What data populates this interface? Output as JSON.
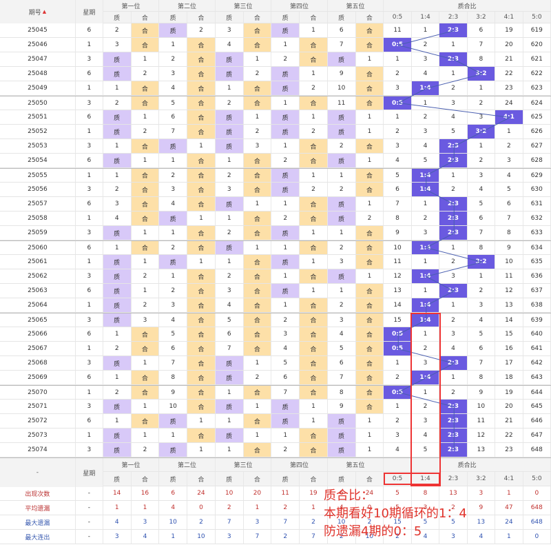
{
  "header": {
    "period": "期号",
    "week": "星期",
    "positions": [
      "第一位",
      "第二位",
      "第三位",
      "第四位",
      "第五位"
    ],
    "zhi": "质",
    "he": "合",
    "ratio_title": "质合比",
    "ratios": [
      "0:5",
      "1:4",
      "2:3",
      "3:2",
      "4:1",
      "5:0"
    ]
  },
  "chart_data": {
    "type": "table",
    "rows": [
      {
        "p": "25045",
        "w": "6",
        "pos": [
          [
            "2",
            "合"
          ],
          [
            "质",
            "2"
          ],
          [
            "3",
            "合"
          ],
          [
            "质",
            "1"
          ],
          [
            "6",
            "合"
          ]
        ],
        "ratio": [
          "11",
          "1",
          "2:3",
          "6",
          "19",
          "619"
        ],
        "hit": 2
      },
      {
        "p": "25046",
        "w": "1",
        "pos": [
          [
            "3",
            "合"
          ],
          [
            "1",
            "合"
          ],
          [
            "4",
            "合"
          ],
          [
            "1",
            "合"
          ],
          [
            "7",
            "合"
          ]
        ],
        "ratio": [
          "0:5",
          "2",
          "1",
          "7",
          "20",
          "620"
        ],
        "hit": 0
      },
      {
        "p": "25047",
        "w": "3",
        "pos": [
          [
            "质",
            "1"
          ],
          [
            "2",
            "合"
          ],
          [
            "质",
            "1"
          ],
          [
            "2",
            "合"
          ],
          [
            "质",
            "1"
          ]
        ],
        "ratio": [
          "1",
          "3",
          "2:3",
          "8",
          "21",
          "621"
        ],
        "hit": 2
      },
      {
        "p": "25048",
        "w": "6",
        "pos": [
          [
            "质",
            "2"
          ],
          [
            "3",
            "合"
          ],
          [
            "质",
            "2"
          ],
          [
            "质",
            "1"
          ],
          [
            "9",
            "合"
          ]
        ],
        "ratio": [
          "2",
          "4",
          "1",
          "3:2",
          "22",
          "622"
        ],
        "hit": 3
      },
      {
        "p": "25049",
        "w": "1",
        "pos": [
          [
            "1",
            "合"
          ],
          [
            "4",
            "合"
          ],
          [
            "1",
            "合"
          ],
          [
            "质",
            "2"
          ],
          [
            "10",
            "合"
          ]
        ],
        "ratio": [
          "3",
          "1:4",
          "2",
          "1",
          "23",
          "623"
        ],
        "hit": 1
      },
      {
        "p": "25050",
        "w": "3",
        "pos": [
          [
            "2",
            "合"
          ],
          [
            "5",
            "合"
          ],
          [
            "2",
            "合"
          ],
          [
            "1",
            "合"
          ],
          [
            "11",
            "合"
          ]
        ],
        "ratio": [
          "0:5",
          "1",
          "3",
          "2",
          "24",
          "624"
        ],
        "hit": 0
      },
      {
        "p": "25051",
        "w": "6",
        "pos": [
          [
            "质",
            "1"
          ],
          [
            "6",
            "合"
          ],
          [
            "质",
            "1"
          ],
          [
            "质",
            "1"
          ],
          [
            "质",
            "1"
          ]
        ],
        "ratio": [
          "1",
          "2",
          "4",
          "3",
          "4:1",
          "625"
        ],
        "hit": 4
      },
      {
        "p": "25052",
        "w": "1",
        "pos": [
          [
            "质",
            "2"
          ],
          [
            "7",
            "合"
          ],
          [
            "质",
            "2"
          ],
          [
            "质",
            "2"
          ],
          [
            "质",
            "1"
          ]
        ],
        "ratio": [
          "2",
          "3",
          "5",
          "3:2",
          "1",
          "626"
        ],
        "hit": 3
      },
      {
        "p": "25053",
        "w": "3",
        "pos": [
          [
            "1",
            "合"
          ],
          [
            "质",
            "1"
          ],
          [
            "质",
            "3"
          ],
          [
            "1",
            "合"
          ],
          [
            "2",
            "合"
          ]
        ],
        "ratio": [
          "3",
          "4",
          "2:3",
          "1",
          "2",
          "627"
        ],
        "hit": 2
      },
      {
        "p": "25054",
        "w": "6",
        "pos": [
          [
            "质",
            "1"
          ],
          [
            "1",
            "合"
          ],
          [
            "1",
            "合"
          ],
          [
            "2",
            "合"
          ],
          [
            "质",
            "1"
          ]
        ],
        "ratio": [
          "4",
          "5",
          "2:3",
          "2",
          "3",
          "628"
        ],
        "hit": 2
      },
      {
        "p": "25055",
        "w": "1",
        "pos": [
          [
            "1",
            "合"
          ],
          [
            "2",
            "合"
          ],
          [
            "2",
            "合"
          ],
          [
            "质",
            "1"
          ],
          [
            "1",
            "合"
          ]
        ],
        "ratio": [
          "5",
          "1:4",
          "1",
          "3",
          "4",
          "629"
        ],
        "hit": 1
      },
      {
        "p": "25056",
        "w": "3",
        "pos": [
          [
            "2",
            "合"
          ],
          [
            "3",
            "合"
          ],
          [
            "3",
            "合"
          ],
          [
            "质",
            "2"
          ],
          [
            "2",
            "合"
          ]
        ],
        "ratio": [
          "6",
          "1:4",
          "2",
          "4",
          "5",
          "630"
        ],
        "hit": 1
      },
      {
        "p": "25057",
        "w": "6",
        "pos": [
          [
            "3",
            "合"
          ],
          [
            "4",
            "合"
          ],
          [
            "质",
            "1"
          ],
          [
            "1",
            "合"
          ],
          [
            "质",
            "1"
          ]
        ],
        "ratio": [
          "7",
          "1",
          "2:3",
          "5",
          "6",
          "631"
        ],
        "hit": 2
      },
      {
        "p": "25058",
        "w": "1",
        "pos": [
          [
            "4",
            "合"
          ],
          [
            "质",
            "1"
          ],
          [
            "1",
            "合"
          ],
          [
            "2",
            "合"
          ],
          [
            "质",
            "2"
          ]
        ],
        "ratio": [
          "8",
          "2",
          "2:3",
          "6",
          "7",
          "632"
        ],
        "hit": 2
      },
      {
        "p": "25059",
        "w": "3",
        "pos": [
          [
            "质",
            "1"
          ],
          [
            "1",
            "合"
          ],
          [
            "2",
            "合"
          ],
          [
            "质",
            "1"
          ],
          [
            "1",
            "合"
          ]
        ],
        "ratio": [
          "9",
          "3",
          "2:3",
          "7",
          "8",
          "633"
        ],
        "hit": 2
      },
      {
        "p": "25060",
        "w": "6",
        "pos": [
          [
            "1",
            "合"
          ],
          [
            "2",
            "合"
          ],
          [
            "质",
            "1"
          ],
          [
            "1",
            "合"
          ],
          [
            "2",
            "合"
          ]
        ],
        "ratio": [
          "10",
          "1:4",
          "1",
          "8",
          "9",
          "634"
        ],
        "hit": 1
      },
      {
        "p": "25061",
        "w": "1",
        "pos": [
          [
            "质",
            "1"
          ],
          [
            "质",
            "1"
          ],
          [
            "1",
            "合"
          ],
          [
            "质",
            "1"
          ],
          [
            "3",
            "合"
          ]
        ],
        "ratio": [
          "11",
          "1",
          "2",
          "3:2",
          "10",
          "635"
        ],
        "hit": 3
      },
      {
        "p": "25062",
        "w": "3",
        "pos": [
          [
            "质",
            "2"
          ],
          [
            "1",
            "合"
          ],
          [
            "2",
            "合"
          ],
          [
            "1",
            "合"
          ],
          [
            "质",
            "1"
          ]
        ],
        "ratio": [
          "12",
          "1:4",
          "3",
          "1",
          "11",
          "636"
        ],
        "hit": 1
      },
      {
        "p": "25063",
        "w": "6",
        "pos": [
          [
            "质",
            "1"
          ],
          [
            "2",
            "合"
          ],
          [
            "3",
            "合"
          ],
          [
            "质",
            "1"
          ],
          [
            "1",
            "合"
          ]
        ],
        "ratio": [
          "13",
          "1",
          "2:3",
          "2",
          "12",
          "637"
        ],
        "hit": 2
      },
      {
        "p": "25064",
        "w": "1",
        "pos": [
          [
            "质",
            "2"
          ],
          [
            "3",
            "合"
          ],
          [
            "4",
            "合"
          ],
          [
            "1",
            "合"
          ],
          [
            "2",
            "合"
          ]
        ],
        "ratio": [
          "14",
          "1:4",
          "1",
          "3",
          "13",
          "638"
        ],
        "hit": 1
      },
      {
        "p": "25065",
        "w": "3",
        "pos": [
          [
            "质",
            "3"
          ],
          [
            "4",
            "合"
          ],
          [
            "5",
            "合"
          ],
          [
            "2",
            "合"
          ],
          [
            "3",
            "合"
          ]
        ],
        "ratio": [
          "15",
          "1:4",
          "2",
          "4",
          "14",
          "639"
        ],
        "hit": 1
      },
      {
        "p": "25066",
        "w": "6",
        "pos": [
          [
            "1",
            "合"
          ],
          [
            "5",
            "合"
          ],
          [
            "6",
            "合"
          ],
          [
            "3",
            "合"
          ],
          [
            "4",
            "合"
          ]
        ],
        "ratio": [
          "0:5",
          "1",
          "3",
          "5",
          "15",
          "640"
        ],
        "hit": 0
      },
      {
        "p": "25067",
        "w": "1",
        "pos": [
          [
            "2",
            "合"
          ],
          [
            "6",
            "合"
          ],
          [
            "7",
            "合"
          ],
          [
            "4",
            "合"
          ],
          [
            "5",
            "合"
          ]
        ],
        "ratio": [
          "0:5",
          "2",
          "4",
          "6",
          "16",
          "641"
        ],
        "hit": 0
      },
      {
        "p": "25068",
        "w": "3",
        "pos": [
          [
            "质",
            "1"
          ],
          [
            "7",
            "合"
          ],
          [
            "质",
            "1"
          ],
          [
            "5",
            "合"
          ],
          [
            "6",
            "合"
          ]
        ],
        "ratio": [
          "1",
          "3",
          "2:3",
          "7",
          "17",
          "642"
        ],
        "hit": 2
      },
      {
        "p": "25069",
        "w": "6",
        "pos": [
          [
            "1",
            "合"
          ],
          [
            "8",
            "合"
          ],
          [
            "质",
            "2"
          ],
          [
            "6",
            "合"
          ],
          [
            "7",
            "合"
          ]
        ],
        "ratio": [
          "2",
          "1:4",
          "1",
          "8",
          "18",
          "643"
        ],
        "hit": 1
      },
      {
        "p": "25070",
        "w": "1",
        "pos": [
          [
            "2",
            "合"
          ],
          [
            "9",
            "合"
          ],
          [
            "1",
            "合"
          ],
          [
            "7",
            "合"
          ],
          [
            "8",
            "合"
          ]
        ],
        "ratio": [
          "0:5",
          "1",
          "2",
          "9",
          "19",
          "644"
        ],
        "hit": 0
      },
      {
        "p": "25071",
        "w": "3",
        "pos": [
          [
            "质",
            "1"
          ],
          [
            "10",
            "合"
          ],
          [
            "质",
            "1"
          ],
          [
            "质",
            "1"
          ],
          [
            "9",
            "合"
          ]
        ],
        "ratio": [
          "1",
          "2",
          "2:3",
          "10",
          "20",
          "645"
        ],
        "hit": 2
      },
      {
        "p": "25072",
        "w": "6",
        "pos": [
          [
            "1",
            "合"
          ],
          [
            "质",
            "1"
          ],
          [
            "1",
            "合"
          ],
          [
            "质",
            "1"
          ],
          [
            "质",
            "1"
          ]
        ],
        "ratio": [
          "2",
          "3",
          "2:3",
          "11",
          "21",
          "646"
        ],
        "hit": 2
      },
      {
        "p": "25073",
        "w": "1",
        "pos": [
          [
            "质",
            "1"
          ],
          [
            "1",
            "合"
          ],
          [
            "质",
            "1"
          ],
          [
            "1",
            "合"
          ],
          [
            "质",
            "1"
          ]
        ],
        "ratio": [
          "3",
          "4",
          "2:3",
          "12",
          "22",
          "647"
        ],
        "hit": 2
      },
      {
        "p": "25074",
        "w": "3",
        "pos": [
          [
            "质",
            "2"
          ],
          [
            "质",
            "1"
          ],
          [
            "1",
            "合"
          ],
          [
            "2",
            "合"
          ],
          [
            "质",
            "1"
          ]
        ],
        "ratio": [
          "4",
          "5",
          "2:3",
          "13",
          "23",
          "648"
        ],
        "hit": 2
      }
    ],
    "footer_period": "-",
    "stats": [
      {
        "label": "出现次数",
        "week": "-",
        "vals": [
          "14",
          "16",
          "6",
          "24",
          "10",
          "20",
          "11",
          "19",
          "6",
          "24"
        ],
        "ratio": [
          "5",
          "8",
          "13",
          "3",
          "1",
          "0"
        ]
      },
      {
        "label": "平均遗漏",
        "week": "-",
        "vals": [
          "1",
          "1",
          "4",
          "0",
          "2",
          "1",
          "2",
          "1",
          "4",
          "0"
        ],
        "ratio": [
          "5",
          "3",
          "2",
          "9",
          "47",
          "648"
        ]
      },
      {
        "label": "最大遗漏",
        "week": "-",
        "vals": [
          "4",
          "3",
          "10",
          "2",
          "7",
          "3",
          "7",
          "2",
          "10",
          "2"
        ],
        "ratio": [
          "15",
          "5",
          "5",
          "13",
          "24",
          "648"
        ]
      },
      {
        "label": "最大连出",
        "week": "-",
        "vals": [
          "3",
          "4",
          "1",
          "10",
          "3",
          "7",
          "2",
          "7",
          "2",
          "10"
        ],
        "ratio": [
          "2",
          "4",
          "3",
          "4",
          "1",
          "0"
        ]
      }
    ]
  },
  "annotation": {
    "line1": "质合比：",
    "line2": "本期看好10期循环的1：4",
    "line3": "防遗漏4期的0：5"
  },
  "colors": {
    "zhi_bg": "#d8c9f8",
    "he_bg": "#fde0a8",
    "hit_bg": "#6a5ae0",
    "highlight": "#e33333"
  }
}
